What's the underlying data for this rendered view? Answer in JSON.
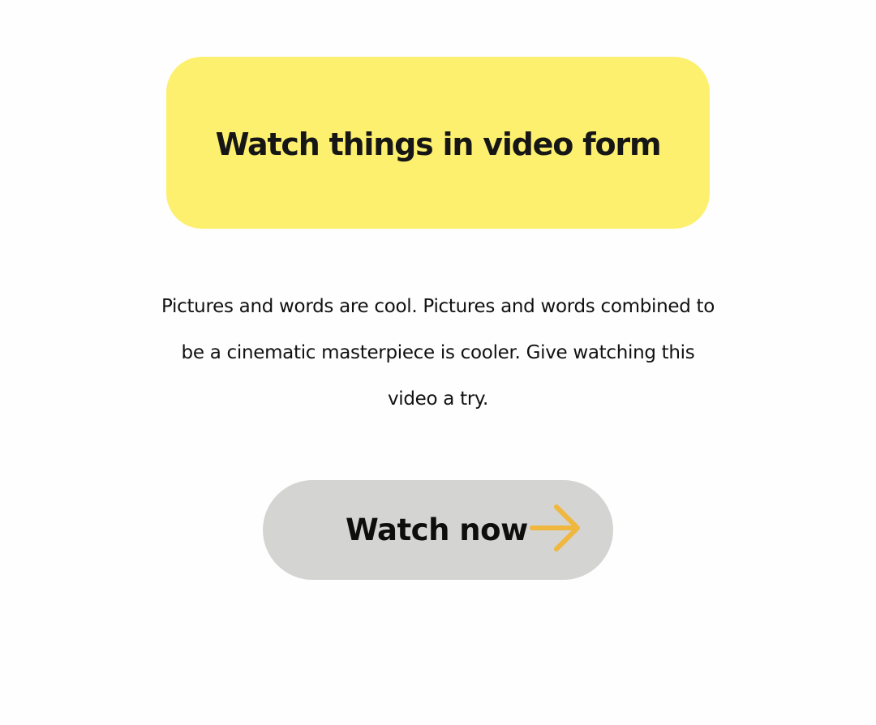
{
  "headline": {
    "text": "Watch things in video form"
  },
  "description": {
    "text": "Pictures and words are cool. Pictures and words combined to be a cinematic masterpiece is cooler. Give watching this video a try."
  },
  "cta": {
    "label": "Watch now",
    "icon": "arrow-right-icon"
  },
  "colors": {
    "background": "#fefefe",
    "headline_card": "#fdf06e",
    "button": "#d4d4d3",
    "arrow": "#f0b73e",
    "text": "#111111"
  }
}
